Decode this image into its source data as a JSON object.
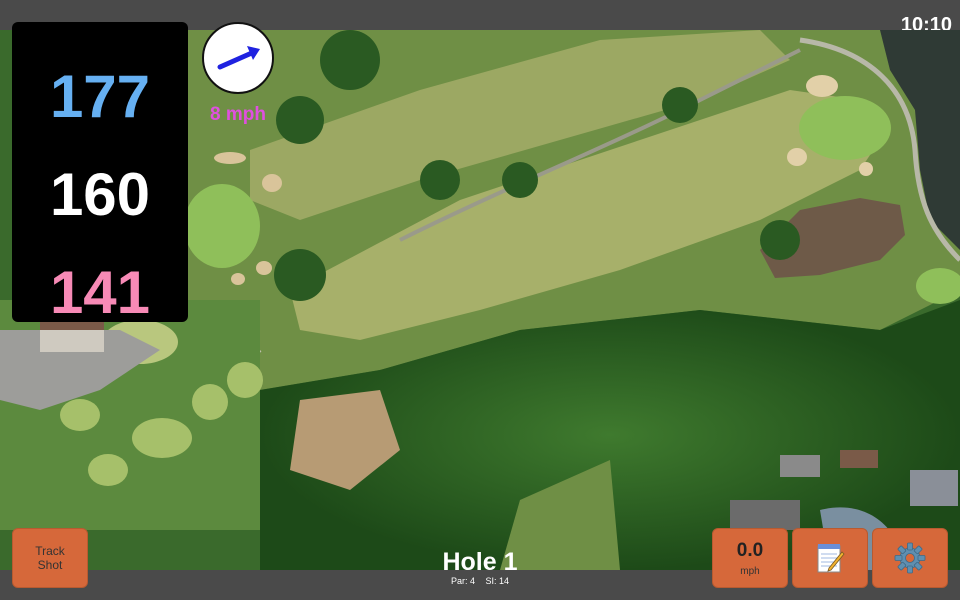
{
  "status": {
    "time": "10:10"
  },
  "distances": {
    "back": "177",
    "middle": "160",
    "front": "141"
  },
  "wind": {
    "speed_label": "8 mph",
    "direction_icon": "wind-arrow-icon",
    "color": "#e04fe0"
  },
  "buttons": {
    "track_shot_line1": "Track",
    "track_shot_line2": "Shot",
    "speed_value": "0.0",
    "speed_unit": "mph",
    "notes_icon": "notepad-icon",
    "settings_icon": "gear-icon"
  },
  "hole": {
    "title": "Hole 1",
    "par": "Par: 4",
    "si": "SI: 14"
  },
  "colors": {
    "accent_button": "#d6683a",
    "back_distance": "#66b0f2",
    "middle_distance": "#ffffff",
    "front_distance": "#f78ab6",
    "bar": "#4a4a4a"
  }
}
